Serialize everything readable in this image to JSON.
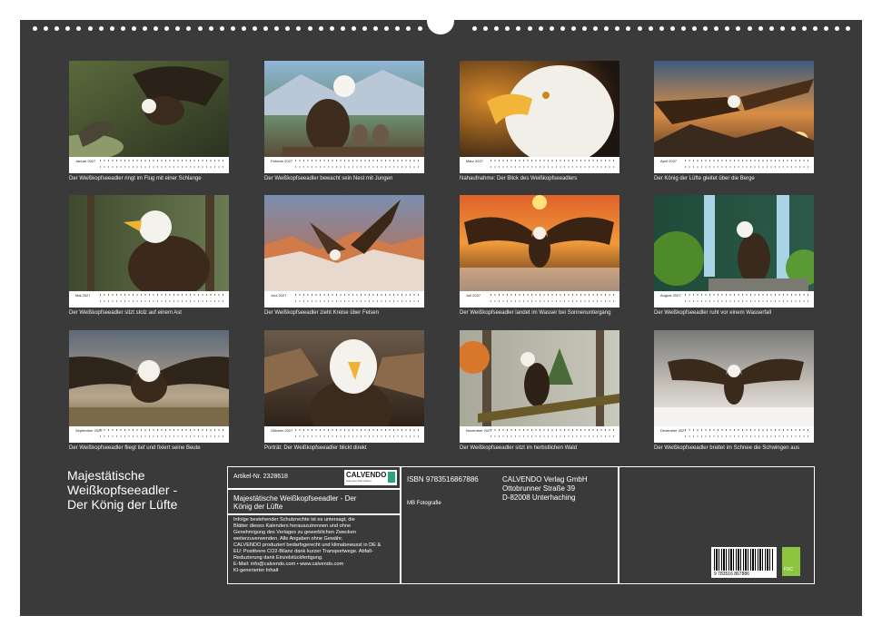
{
  "months": [
    {
      "name": "Januar 2027",
      "caption": "Der Weißkopfseeadler ringt im Flug mit einer Schlange"
    },
    {
      "name": "Februar 2027",
      "caption": "Der Weißkopfseeadler bewacht sein Nest mit Jungen"
    },
    {
      "name": "März 2027",
      "caption": "Nahaufnahme: Der Blick des Weißkopfseeadlers"
    },
    {
      "name": "April 2027",
      "caption": "Der König der Lüfte gleitet über die Berge"
    },
    {
      "name": "Mai 2027",
      "caption": "Der Weißkopfseeadler sitzt stolz auf einem Ast"
    },
    {
      "name": "Juni 2027",
      "caption": "Der Weißkopfseeadler zieht Kreise über Felsen"
    },
    {
      "name": "Juli 2027",
      "caption": "Der Weißkopfseeadler landet im Wasser bei Sonnenuntergang"
    },
    {
      "name": "August 2027",
      "caption": "Der Weißkopfseeadler ruht vor einem Wasserfall"
    },
    {
      "name": "September 2027",
      "caption": "Der Weißkopfseeadler fliegt tief und fixiert seine Beute"
    },
    {
      "name": "Oktober 2027",
      "caption": "Porträt: Der Weißkopfseeadler blickt direkt"
    },
    {
      "name": "November 2027",
      "caption": "Der Weißkopfseeadler sitzt im herbstlichen Wald"
    },
    {
      "name": "Dezember 2027",
      "caption": "Der Weißkopfseeadler breitet im Schnee die Schwingen aus"
    }
  ],
  "title_lines": [
    "Majestätische",
    "Weißkopfseeadler -",
    "Der König der Lüfte"
  ],
  "info": {
    "article_no": "Artikel-Nr. 2328618",
    "logo_text": "CALVENDO",
    "logo_sub": "Kalender-Manufaktur",
    "subtitle_line1": "Majestätische Weißkopfseeadler - Der",
    "subtitle_line2": "König der Lüfte",
    "legal": [
      "Infolge bestehender Schutzrechte ist es untersagt, die",
      "Blätter dieses Kalenders herauszutrennen und ohne",
      "Genehmigung des Verlages zu gewerblichen Zwecken",
      "weiterzuverwenden. Alle Angaben ohne Gewähr.",
      "CALVENDO produziert bedarfsgerecht und klimabewusst in DE &",
      "EU: Positivere CO2-Bilanz dank kurzer Transportwege. Abfall-",
      "Reduzierung dank Einzelstückfertigung.",
      "E-Mail: info@calvendo.com • www.calvendo.com",
      "KI-generierter Inhalt"
    ],
    "isbn": "ISBN 9783516867886",
    "author": "MB Fotografie",
    "publisher_lines": [
      "CALVENDO Verlag GmbH",
      "Ottobrunner Straße 39",
      "D-82008 Unterhaching"
    ],
    "barcode_number": "9 783516 867886",
    "leaf_label": "FSC"
  }
}
